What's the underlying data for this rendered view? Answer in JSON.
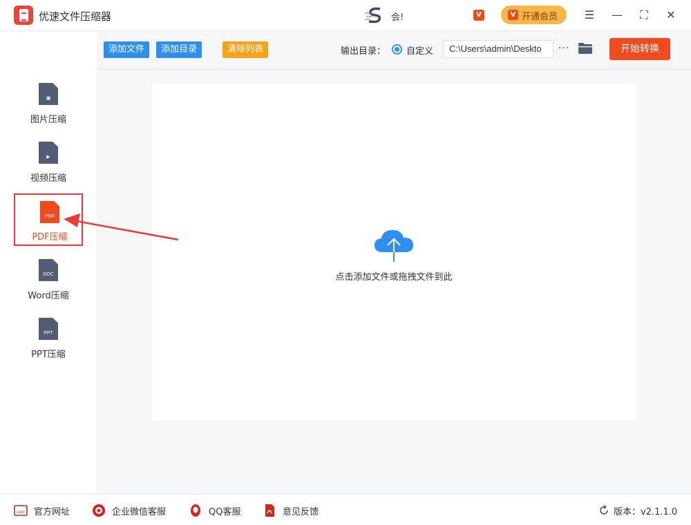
{
  "app": {
    "title": "优速文件压缩器"
  },
  "titlebar": {
    "member_text": "会!",
    "vip_mini": "V",
    "vip_button": {
      "mark": "V",
      "label": "开通会员"
    },
    "menu_glyph": "☰",
    "minimize_glyph": "—",
    "maximize_glyph": "⛶",
    "close_glyph": "✕"
  },
  "sidebar": {
    "items": [
      {
        "label": "图片压缩",
        "icon_text": "▣",
        "active": false
      },
      {
        "label": "视频压缩",
        "icon_text": "▶",
        "active": false
      },
      {
        "label": "PDF压缩",
        "icon_text": "PDF",
        "active": true
      },
      {
        "label": "Word压缩",
        "icon_text": "DOC",
        "active": false
      },
      {
        "label": "PPT压缩",
        "icon_text": "PPT",
        "active": false
      }
    ]
  },
  "toolbar": {
    "add_file": "添加文件",
    "add_dir": "添加目录",
    "clear_list": "清除列表",
    "output_label": "输出目录：",
    "radio_label": "自定义",
    "output_path": "C:\\Users\\admin\\Deskto",
    "more": "···",
    "start": "开始转换"
  },
  "dropzone": {
    "text": "点击添加文件或拖拽文件到此"
  },
  "footer": {
    "links": [
      {
        "label": "官方网址",
        "icon": "website-icon"
      },
      {
        "label": "企业微信客服",
        "icon": "wechat-service-icon"
      },
      {
        "label": "QQ客服",
        "icon": "qq-icon"
      },
      {
        "label": "意见反馈",
        "icon": "feedback-icon"
      }
    ],
    "version": "版本：v2.1.1.0"
  },
  "colors": {
    "accent_blue": "#2e8ff0",
    "accent_orange": "#f7a21b",
    "accent_red": "#f04a1f",
    "vip_gold": "#f7b64a"
  }
}
